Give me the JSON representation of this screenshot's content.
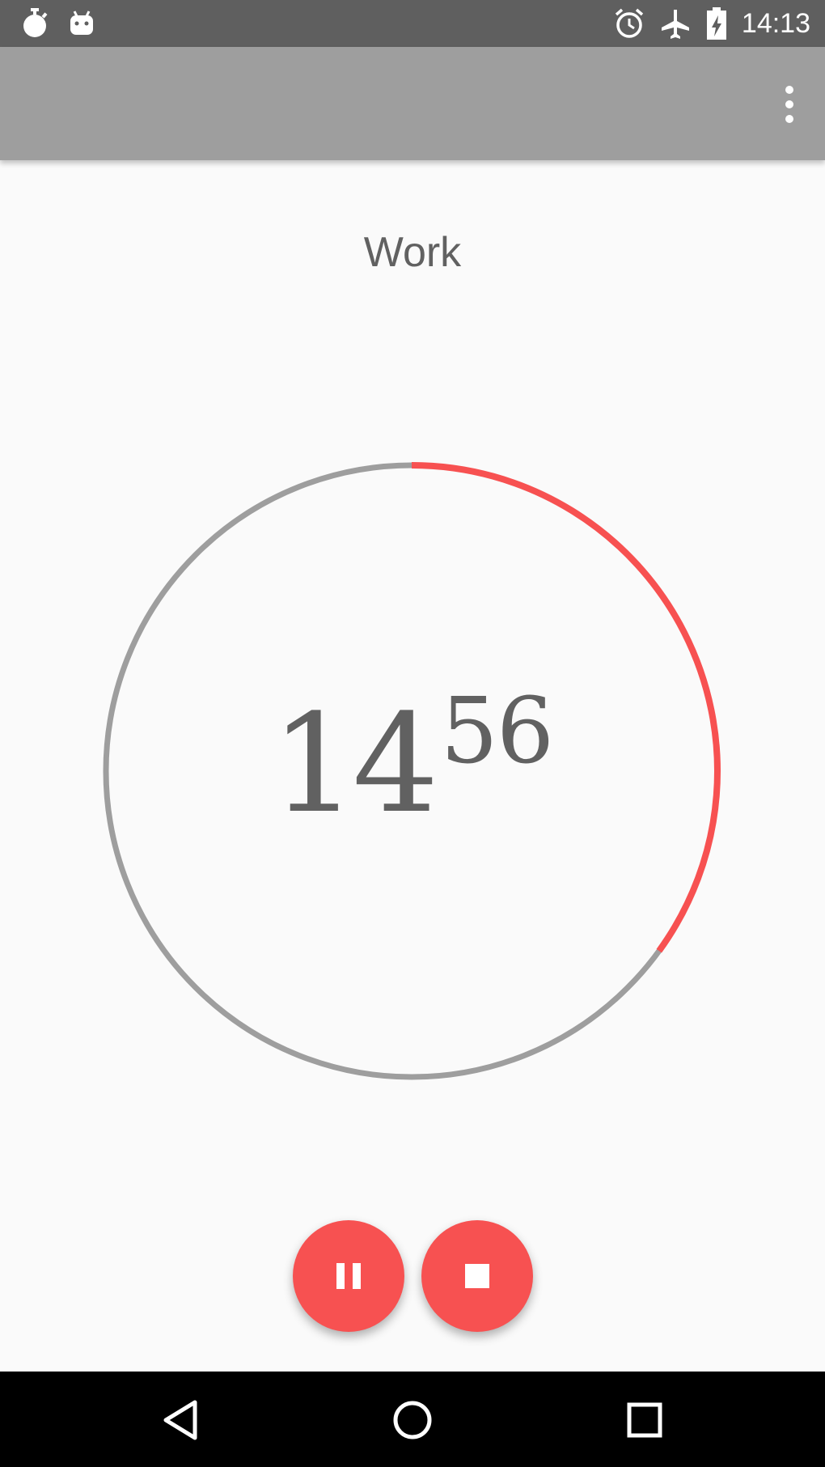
{
  "status_bar": {
    "time": "14:13",
    "left_icons": [
      "stopwatch-icon",
      "android-icon"
    ],
    "right_icons": [
      "alarm-icon",
      "airplane-mode-icon",
      "battery-charging-icon"
    ]
  },
  "app_bar": {
    "overflow_icon": "more-vert-icon"
  },
  "session": {
    "label": "Work"
  },
  "timer": {
    "minutes": "14",
    "seconds": "56",
    "progress_fraction": 0.35,
    "track_color": "#9e9e9e",
    "progress_color": "#f75151"
  },
  "controls": {
    "pause_icon": "pause-icon",
    "stop_icon": "stop-icon",
    "accent_color": "#f75151"
  },
  "nav_bar": {
    "icons": [
      "back-icon",
      "home-icon",
      "recents-icon"
    ]
  }
}
